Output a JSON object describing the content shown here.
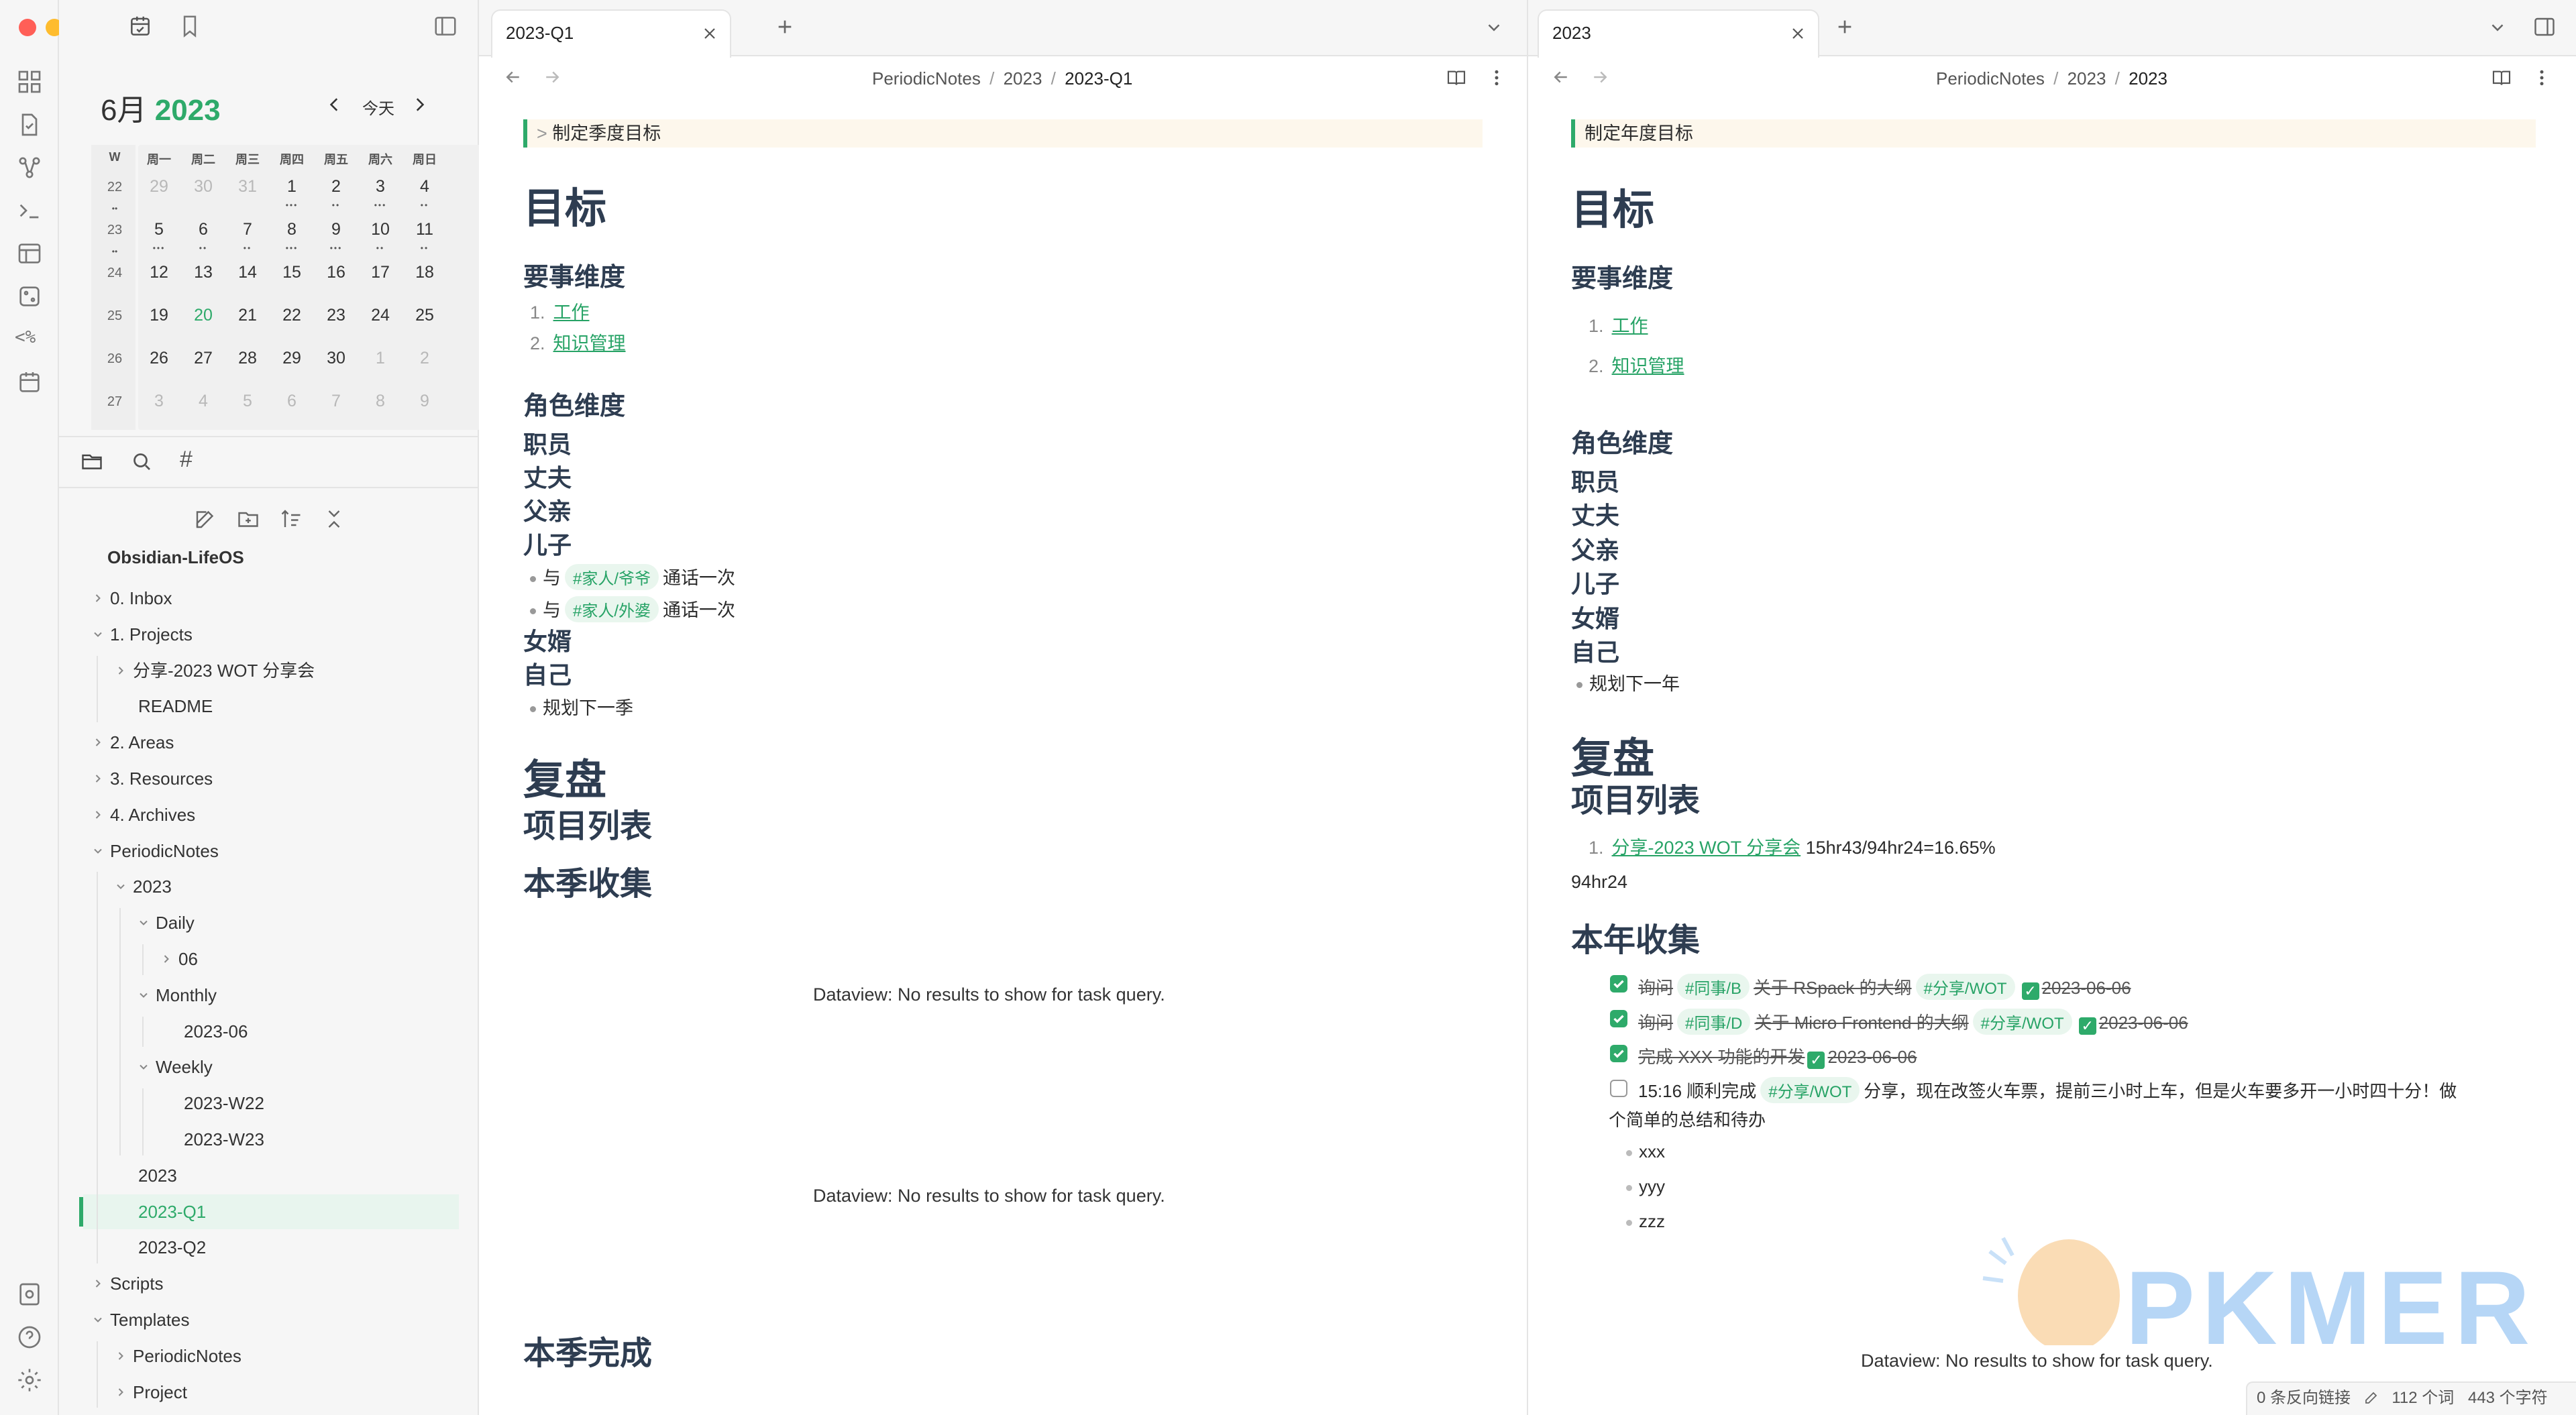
{
  "calendar": {
    "month": "6月",
    "year": "2023",
    "today_label": "今天",
    "weekday_headers": [
      "W",
      "周一",
      "周二",
      "周三",
      "周四",
      "周五",
      "周六",
      "周日"
    ],
    "weeks": [
      {
        "week": "22",
        "days": [
          "29",
          "30",
          "31",
          "1",
          "2",
          "3",
          "4"
        ]
      },
      {
        "week": "23",
        "days": [
          "5",
          "6",
          "7",
          "8",
          "9",
          "10",
          "11"
        ]
      },
      {
        "week": "24",
        "days": [
          "12",
          "13",
          "14",
          "15",
          "16",
          "17",
          "18"
        ]
      },
      {
        "week": "25",
        "days": [
          "19",
          "20",
          "21",
          "22",
          "23",
          "24",
          "25"
        ]
      },
      {
        "week": "26",
        "days": [
          "26",
          "27",
          "28",
          "29",
          "30",
          "1",
          "2"
        ]
      },
      {
        "week": "27",
        "days": [
          "3",
          "4",
          "5",
          "6",
          "7",
          "8",
          "9"
        ]
      }
    ],
    "today": "20"
  },
  "file_tree": {
    "vault": "Obsidian-LifeOS",
    "items": [
      {
        "label": "0. Inbox"
      },
      {
        "label": "1. Projects"
      },
      {
        "label": "分享-2023 WOT 分享会"
      },
      {
        "label": "README"
      },
      {
        "label": "2. Areas"
      },
      {
        "label": "3. Resources"
      },
      {
        "label": "4. Archives"
      },
      {
        "label": "PeriodicNotes"
      },
      {
        "label": "2023"
      },
      {
        "label": "Daily"
      },
      {
        "label": "06"
      },
      {
        "label": "Monthly"
      },
      {
        "label": "2023-06"
      },
      {
        "label": "Weekly"
      },
      {
        "label": "2023-W22"
      },
      {
        "label": "2023-W23"
      },
      {
        "label": "2023"
      },
      {
        "label": "2023-Q1"
      },
      {
        "label": "2023-Q2"
      },
      {
        "label": "Scripts"
      },
      {
        "label": "Templates"
      },
      {
        "label": "PeriodicNotes"
      },
      {
        "label": "Project"
      }
    ]
  },
  "left_pane": {
    "tab_title": "2023-Q1",
    "breadcrumb": [
      "PeriodicNotes",
      "/",
      "2023",
      "/",
      "2023-Q1"
    ],
    "callout": "制定季度目标",
    "h_goal": "目标",
    "h_key": "要事维度",
    "key_items": [
      "1.",
      "工作",
      "2.",
      "知识管理"
    ],
    "h_role": "角色维度",
    "roles": [
      "职员",
      "丈夫",
      "父亲",
      "儿子"
    ],
    "call_1": {
      "pre": "与",
      "tag": "#家人/爷爷",
      "post": "通话一次"
    },
    "call_2": {
      "pre": "与",
      "tag": "#家人/外婆",
      "post": "通话一次"
    },
    "roles_2": [
      "女婿",
      "自己"
    ],
    "plan": "规划下一季",
    "h_review": "复盘",
    "h_projects": "项目列表",
    "h_collect": "本季收集",
    "dv_1": "Dataview: No results to show for task query.",
    "dv_2": "Dataview: No results to show for task query.",
    "h_done": "本季完成"
  },
  "right_pane": {
    "tab_title": "2023",
    "breadcrumb": [
      "PeriodicNotes",
      "/",
      "2023",
      "/",
      "2023"
    ],
    "callout": "制定年度目标",
    "h_goal": "目标",
    "h_key": "要事维度",
    "key_items": [
      "1.",
      "工作",
      "2.",
      "知识管理"
    ],
    "h_role": "角色维度",
    "roles": [
      "职员",
      "丈夫",
      "父亲",
      "儿子",
      "女婿",
      "自己"
    ],
    "plan": "规划下一年",
    "h_review": "复盘",
    "h_projects": "项目列表",
    "project": {
      "num": "1.",
      "link": "分享-2023 WOT 分享会",
      "stat": "15hr43/94hr24=16.65%"
    },
    "total": "94hr24",
    "h_collect": "本年收集",
    "tasks": [
      {
        "a": "询问",
        "tag1": "#同事/B",
        "b": "关于 RSpack 的大纲",
        "tag2": "#分享/WOT",
        "check": "✓",
        "date": "2023-06-06"
      },
      {
        "a": "询问",
        "tag1": "#同事/D",
        "b": "关于 Micro Frontend 的大纲",
        "tag2": "#分享/WOT",
        "check": "✓",
        "date": "2023-06-06"
      },
      {
        "a": "完成 XXX 功能的开发",
        "check": "✓",
        "date": "2023-06-06"
      }
    ],
    "open_task": {
      "pre": "15:16 顺利完成",
      "tag": "#分享/WOT",
      "post": "分享，现在改签火车票，提前三小时上车，但是火车要多开一小时四十分！做",
      "line2": "个简单的总结和待办"
    },
    "subitems": [
      "xxx",
      "yyy",
      "zzz"
    ],
    "dv": "Dataview: No results to show for task query."
  },
  "status_bar": {
    "backlinks": "0 条反向链接",
    "words": "112 个词",
    "chars": "443 个字符"
  },
  "watermark": "PKMER",
  "colors": {
    "accent": "#2eaa6a",
    "heading": "#2e3d51",
    "link": "#27a366"
  }
}
